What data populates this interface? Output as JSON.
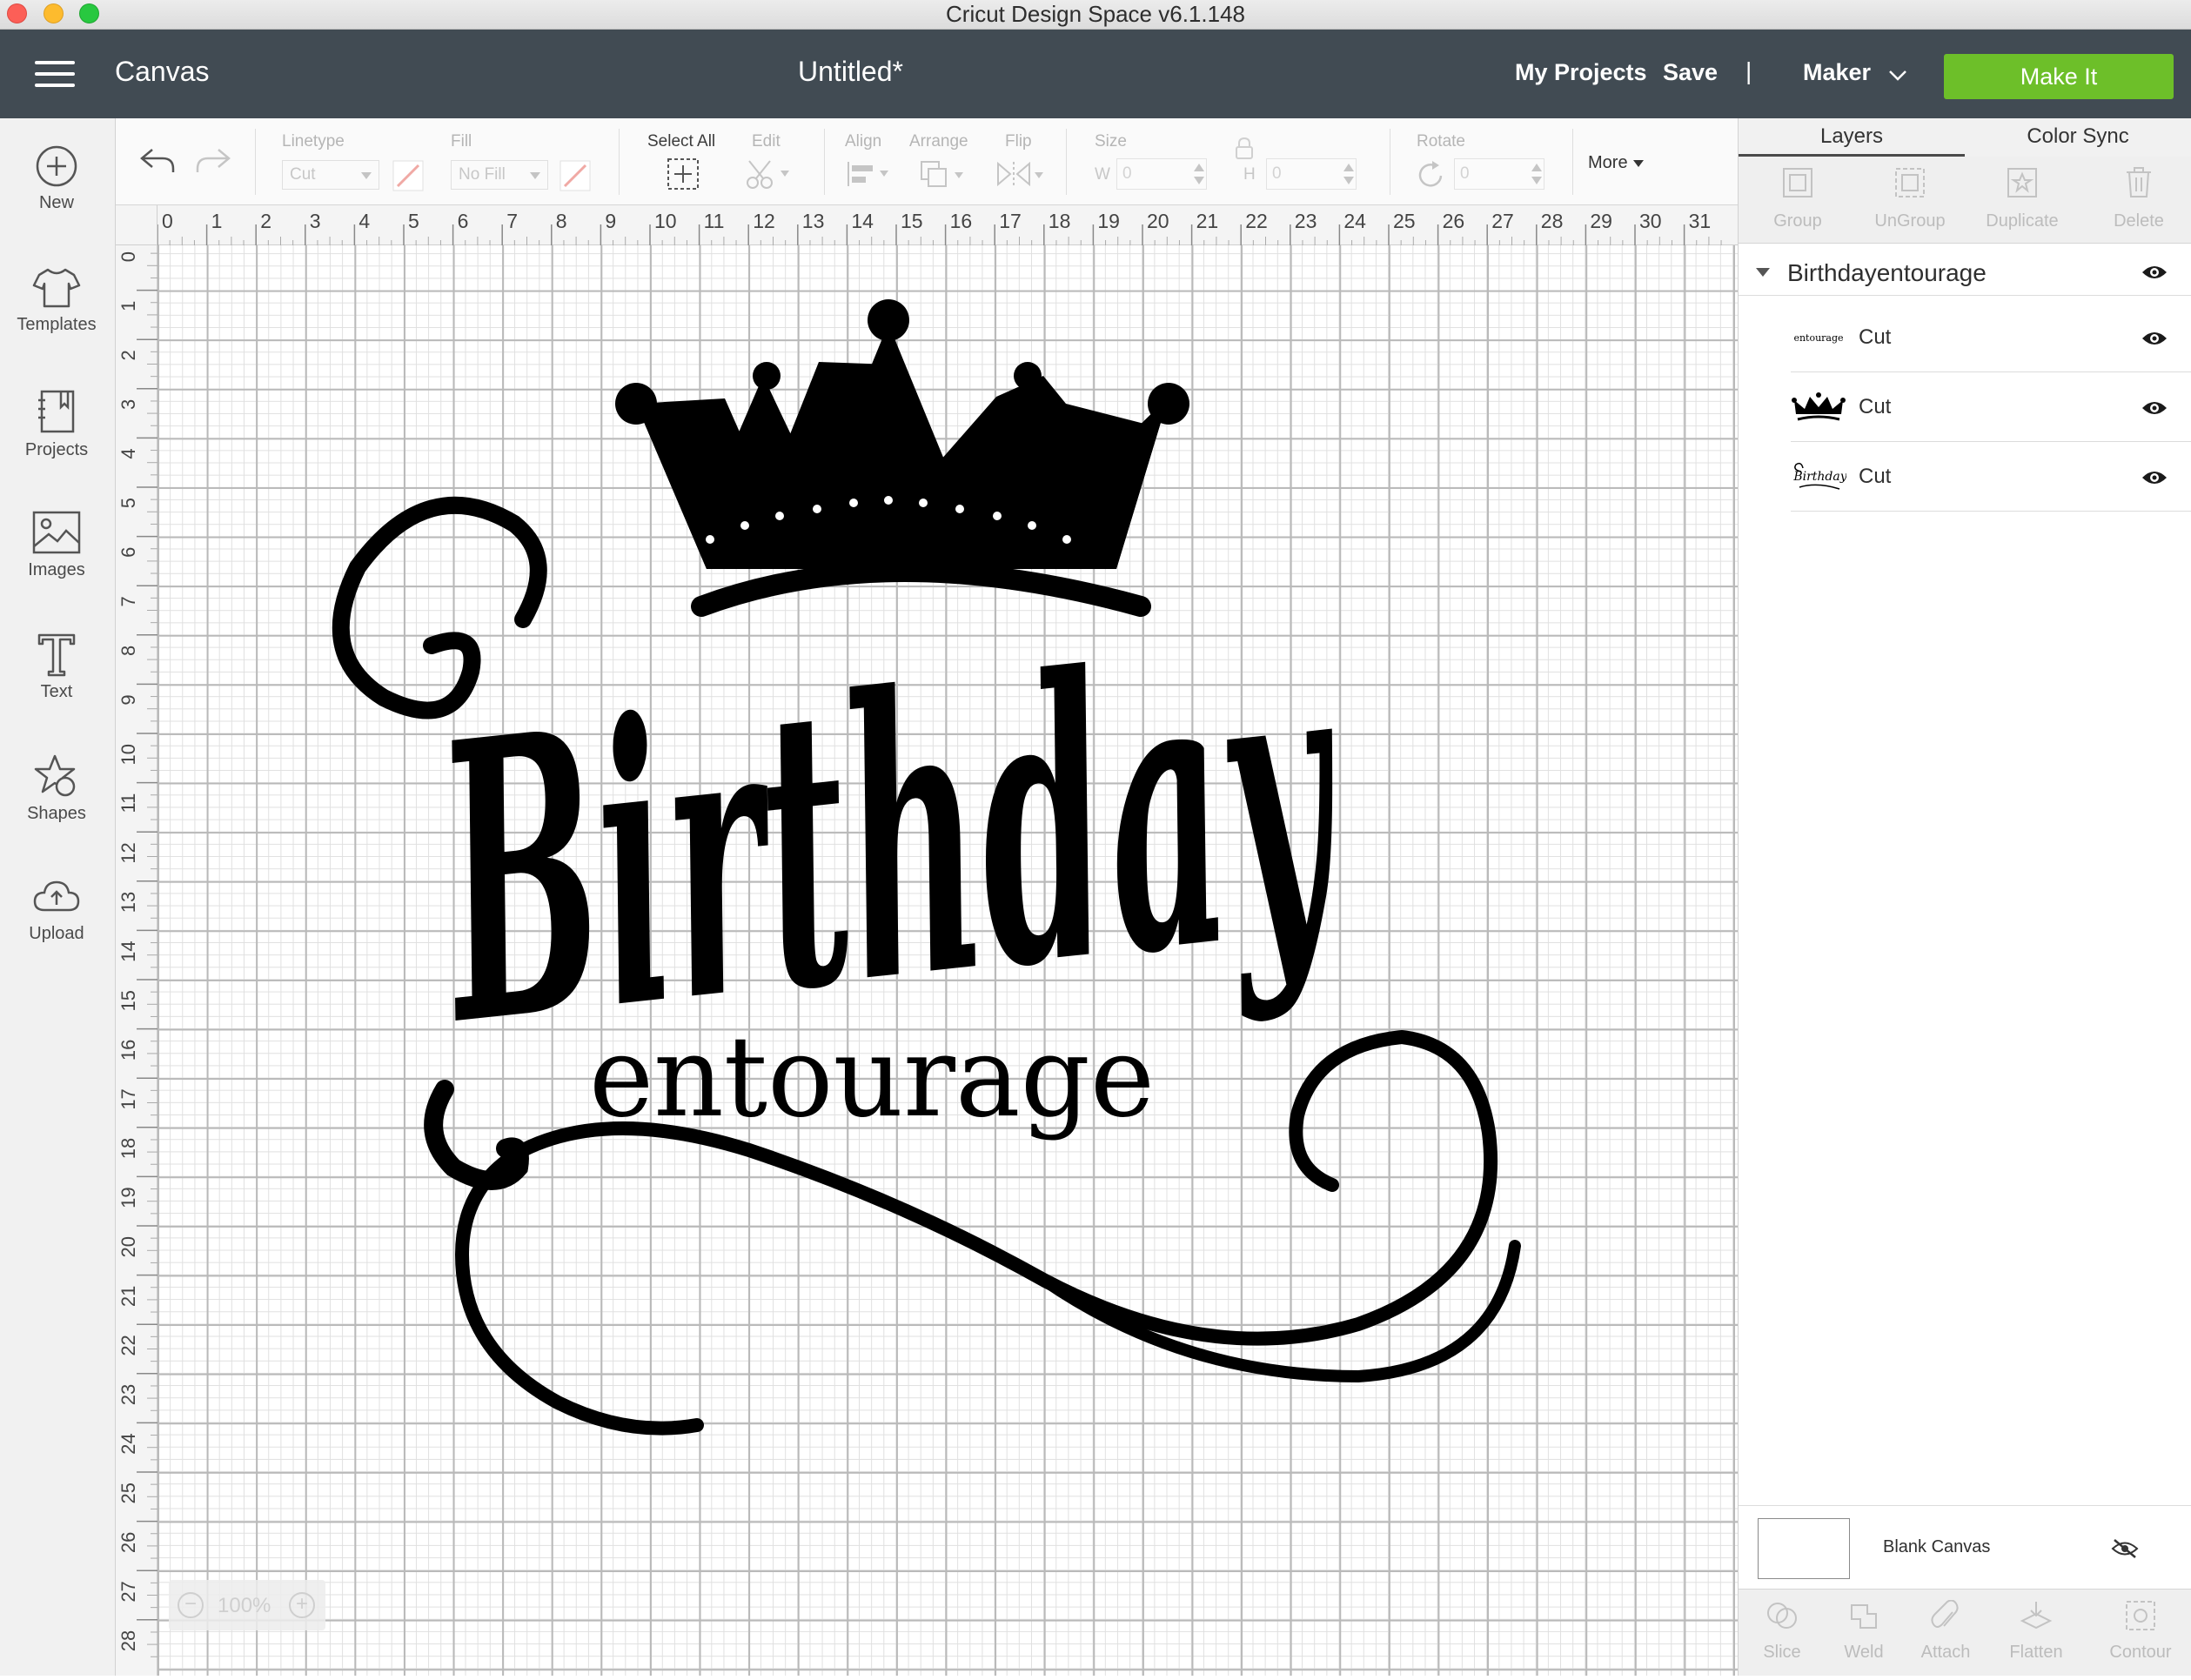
{
  "window": {
    "title": "Cricut Design Space  v6.1.148"
  },
  "header": {
    "section": "Canvas",
    "project_name": "Untitled*",
    "my_projects": "My Projects",
    "save": "Save",
    "separator": "|",
    "machine": "Maker",
    "make_it": "Make It",
    "accent_color": "#6dbf29",
    "bg_color": "#414b53"
  },
  "sidebar": {
    "items": [
      {
        "label": "New",
        "icon": "plus-circle-icon"
      },
      {
        "label": "Templates",
        "icon": "tshirt-icon"
      },
      {
        "label": "Projects",
        "icon": "projects-icon"
      },
      {
        "label": "Images",
        "icon": "image-icon"
      },
      {
        "label": "Text",
        "icon": "text-icon"
      },
      {
        "label": "Shapes",
        "icon": "shapes-icon"
      },
      {
        "label": "Upload",
        "icon": "upload-cloud-icon"
      }
    ]
  },
  "toolbar": {
    "linetype_label": "Linetype",
    "linetype_value": "Cut",
    "fill_label": "Fill",
    "fill_value": "No Fill",
    "select_all": "Select All",
    "edit": "Edit",
    "align": "Align",
    "arrange": "Arrange",
    "flip": "Flip",
    "size": "Size",
    "w_label": "W",
    "w_value": "0",
    "h_label": "H",
    "h_value": "0",
    "rotate": "Rotate",
    "rotate_value": "0",
    "more": "More"
  },
  "rulers": {
    "horizontal": [
      "0",
      "1",
      "2",
      "3",
      "4",
      "5",
      "6",
      "7",
      "8",
      "9",
      "10",
      "11",
      "12",
      "13",
      "14",
      "15",
      "16",
      "17",
      "18",
      "19",
      "20",
      "21",
      "22",
      "23",
      "24",
      "25",
      "26",
      "27",
      "28",
      "29",
      "30",
      "31"
    ],
    "vertical": [
      "0",
      "1",
      "2",
      "3",
      "4",
      "5",
      "6",
      "7",
      "8",
      "9",
      "10",
      "11",
      "12",
      "13",
      "14",
      "15",
      "16",
      "17",
      "18",
      "19",
      "20",
      "21",
      "22",
      "23",
      "24",
      "25",
      "26",
      "27",
      "28"
    ]
  },
  "canvas": {
    "design_word_1": "Birthday",
    "design_word_2": "entourage",
    "zoom": "100%"
  },
  "panel": {
    "tabs": [
      "Layers",
      "Color Sync"
    ],
    "actions": [
      "Group",
      "UnGroup",
      "Duplicate",
      "Delete"
    ],
    "group_name": "Birthdayentourage",
    "layers": [
      {
        "thumb_text": "entourage",
        "operation": "Cut"
      },
      {
        "thumb_text": "",
        "operation": "Cut"
      },
      {
        "thumb_text": "Birthday",
        "operation": "Cut"
      }
    ],
    "blank_canvas": "Blank Canvas",
    "bottom_actions": [
      "Slice",
      "Weld",
      "Attach",
      "Flatten",
      "Contour"
    ]
  }
}
